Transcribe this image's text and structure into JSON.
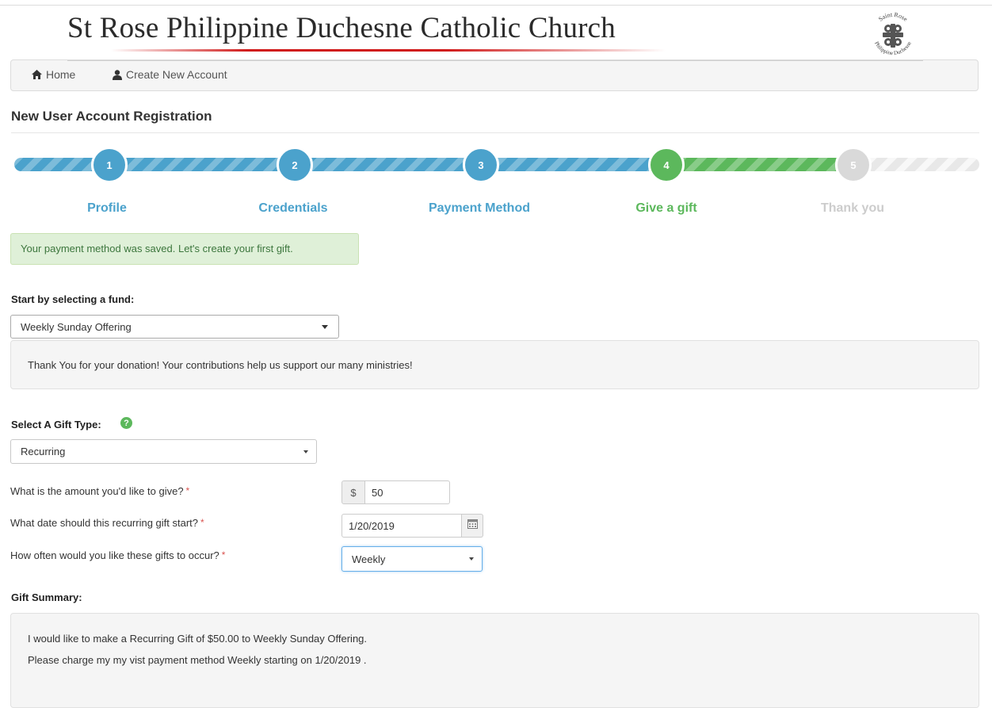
{
  "header": {
    "church_name": "St Rose Philippine Duchesne Catholic Church",
    "logo_text_top": "Saint Rose",
    "logo_text_bottom": "Philippine Duchesne"
  },
  "nav": {
    "home_label": "Home",
    "create_account_label": "Create New Account"
  },
  "page": {
    "heading": "New User Account Registration"
  },
  "stepper": {
    "steps": [
      {
        "number": "1",
        "label": "Profile",
        "state": "complete"
      },
      {
        "number": "2",
        "label": "Credentials",
        "state": "complete"
      },
      {
        "number": "3",
        "label": "Payment Method",
        "state": "complete"
      },
      {
        "number": "4",
        "label": "Give a gift",
        "state": "active"
      },
      {
        "number": "5",
        "label": "Thank you",
        "state": "pending"
      }
    ],
    "colors": {
      "complete": "#4ba2cc",
      "active": "#5cb85c",
      "pending": "#d9d9d9"
    }
  },
  "alert": {
    "message": "Your payment method was saved. Let's create your first gift."
  },
  "fund": {
    "label": "Start by selecting a fund:",
    "selected": "Weekly Sunday Offering",
    "description": "Thank You for your donation! Your contributions help us support our many ministries!"
  },
  "gift_type": {
    "label": "Select A Gift Type:",
    "help_icon": "question-circle-icon",
    "selected": "Recurring"
  },
  "amount": {
    "question": "What is the amount you'd like to give?",
    "required_mark": "*",
    "currency_symbol": "$",
    "value": "50"
  },
  "start_date": {
    "question": "What date should this recurring gift start?",
    "required_mark": "*",
    "value": "1/20/2019"
  },
  "frequency": {
    "question": "How often would you like these gifts to occur?",
    "required_mark": "*",
    "selected": "Weekly"
  },
  "summary": {
    "label": "Gift Summary:",
    "line1": "I would like to make a Recurring Gift of $50.00 to Weekly Sunday Offering.",
    "line2": "Please charge my my vist payment method Weekly starting on 1/20/2019 ."
  }
}
